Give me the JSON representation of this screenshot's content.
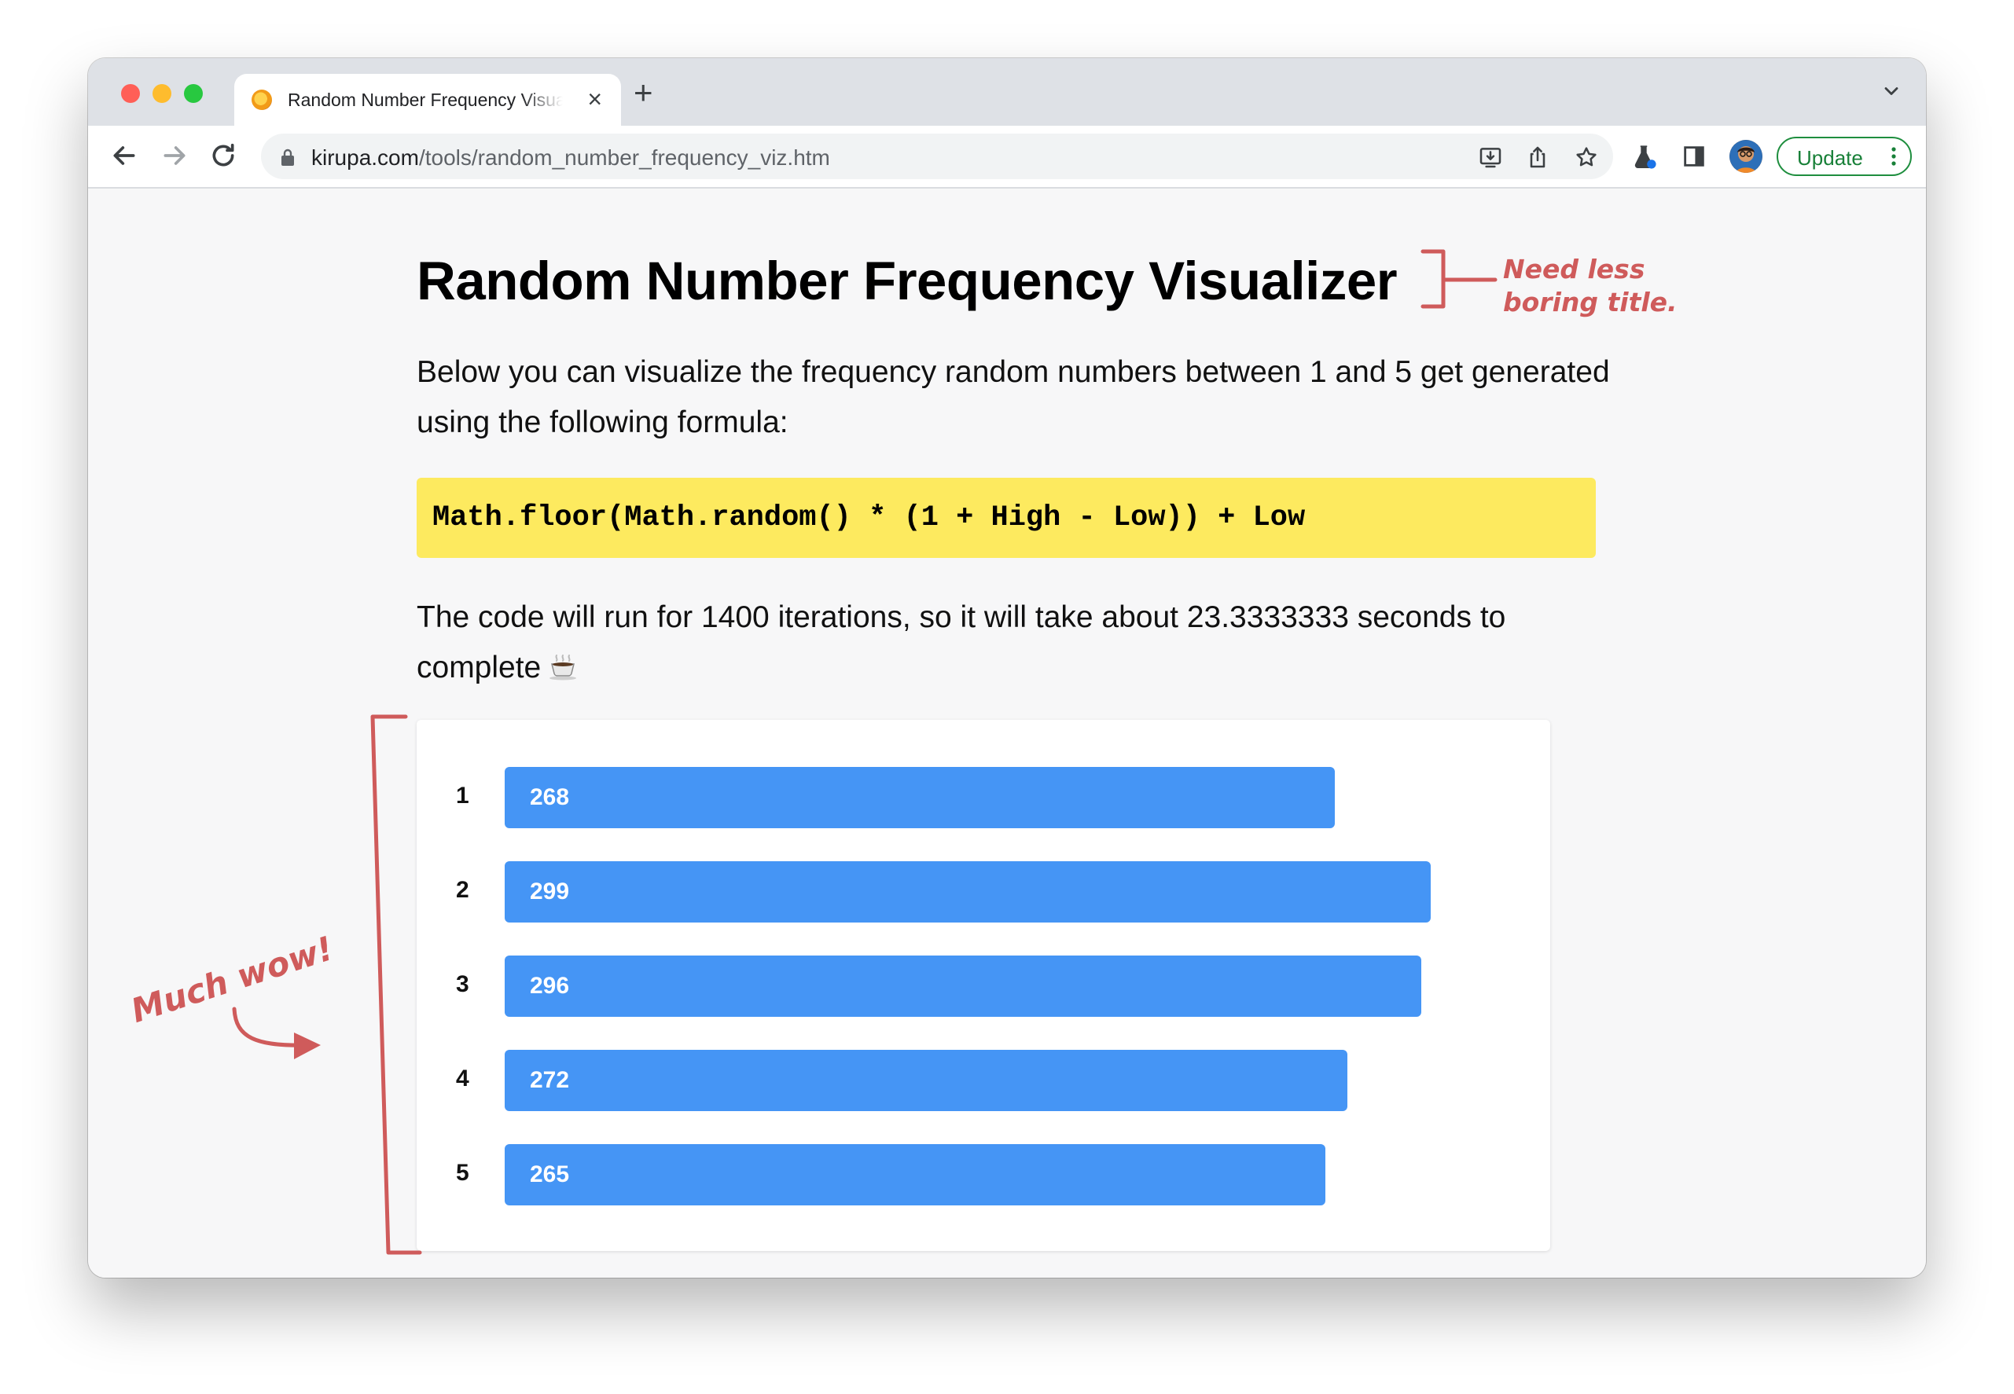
{
  "browser": {
    "tab": {
      "title": "Random Number Frequency Visualizer",
      "close_icon": "×"
    },
    "new_tab_label": "+",
    "url": {
      "domain": "kirupa.com",
      "path": "/tools/random_number_frequency_viz.htm"
    },
    "update_label": "Update"
  },
  "page": {
    "title": "Random Number Frequency Visualizer",
    "intro": "Below you can visualize the frequency random numbers between 1 and 5 get generated using the following formula:",
    "formula": "Math.floor(Math.random() * (1 + High - Low)) + Low",
    "run_info": "The code will run for 1400 iterations, so it will take about 23.3333333 seconds to complete"
  },
  "annotations": {
    "title_note_line1": "Need less",
    "title_note_line2": "boring title.",
    "chart_note": "Much wow!"
  },
  "colors": {
    "bar": "#4595f5",
    "annotation": "#cf5b5b",
    "code_background": "#fdea5f"
  },
  "chart_data": {
    "type": "bar",
    "orientation": "horizontal",
    "categories": [
      "1",
      "2",
      "3",
      "4",
      "5"
    ],
    "values": [
      268,
      299,
      296,
      272,
      265
    ],
    "title": "",
    "xlabel": "",
    "ylabel": "",
    "xlim": [
      0,
      330
    ],
    "grid": false,
    "legend": "none"
  }
}
